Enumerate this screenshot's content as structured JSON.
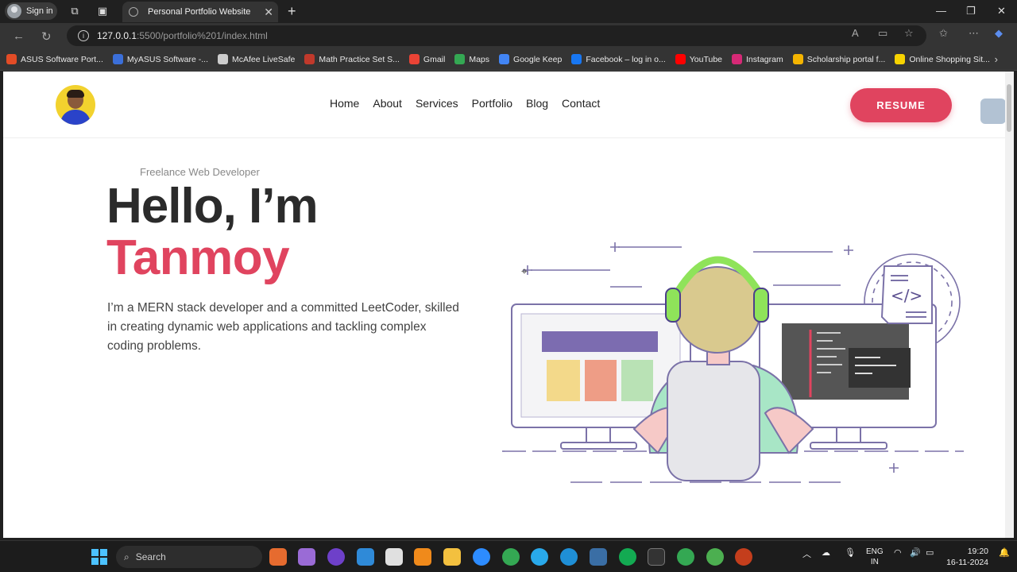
{
  "browser": {
    "signin_label": "Sign in",
    "tab_title": "Personal Portfolio Website",
    "url_host": "127.0.0.1",
    "url_path": ":5500/portfolio%201/index.html",
    "bookmarks": [
      {
        "label": "ASUS Software Port...",
        "color": "#e34c26"
      },
      {
        "label": "MyASUS Software -...",
        "color": "#3b6fd9"
      },
      {
        "label": "McAfee LiveSafe",
        "color": "#cccccc"
      },
      {
        "label": "Math Practice Set S...",
        "color": "#c0392b"
      },
      {
        "label": "Gmail",
        "color": "#ea4335"
      },
      {
        "label": "Maps",
        "color": "#34a853"
      },
      {
        "label": "Google Keep",
        "color": "#4285f4"
      },
      {
        "label": "Facebook – log in o...",
        "color": "#1877f2"
      },
      {
        "label": "YouTube",
        "color": "#ff0000"
      },
      {
        "label": "Instagram",
        "color": "#d62976"
      },
      {
        "label": "Scholarship portal f...",
        "color": "#f4b400"
      },
      {
        "label": "Online Shopping Sit...",
        "color": "#f7d300"
      }
    ]
  },
  "page": {
    "menu": [
      "Home",
      "About",
      "Services",
      "Portfolio",
      "Blog",
      "Contact"
    ],
    "resume_label": "RESUME",
    "tagline": "Freelance Web Developer",
    "hello": "Hello, I’m",
    "name": "Tanmoy",
    "bio": "I’m a MERN stack developer and a committed LeetCoder, skilled in creating dynamic web applications and tackling complex coding problems.",
    "code_badge": "</>",
    "accent_color": "#e0445f"
  },
  "taskbar": {
    "search_label": "Search",
    "lang_line1": "ENG",
    "lang_line2": "IN",
    "time": "19:20",
    "date": "16-11-2024"
  }
}
